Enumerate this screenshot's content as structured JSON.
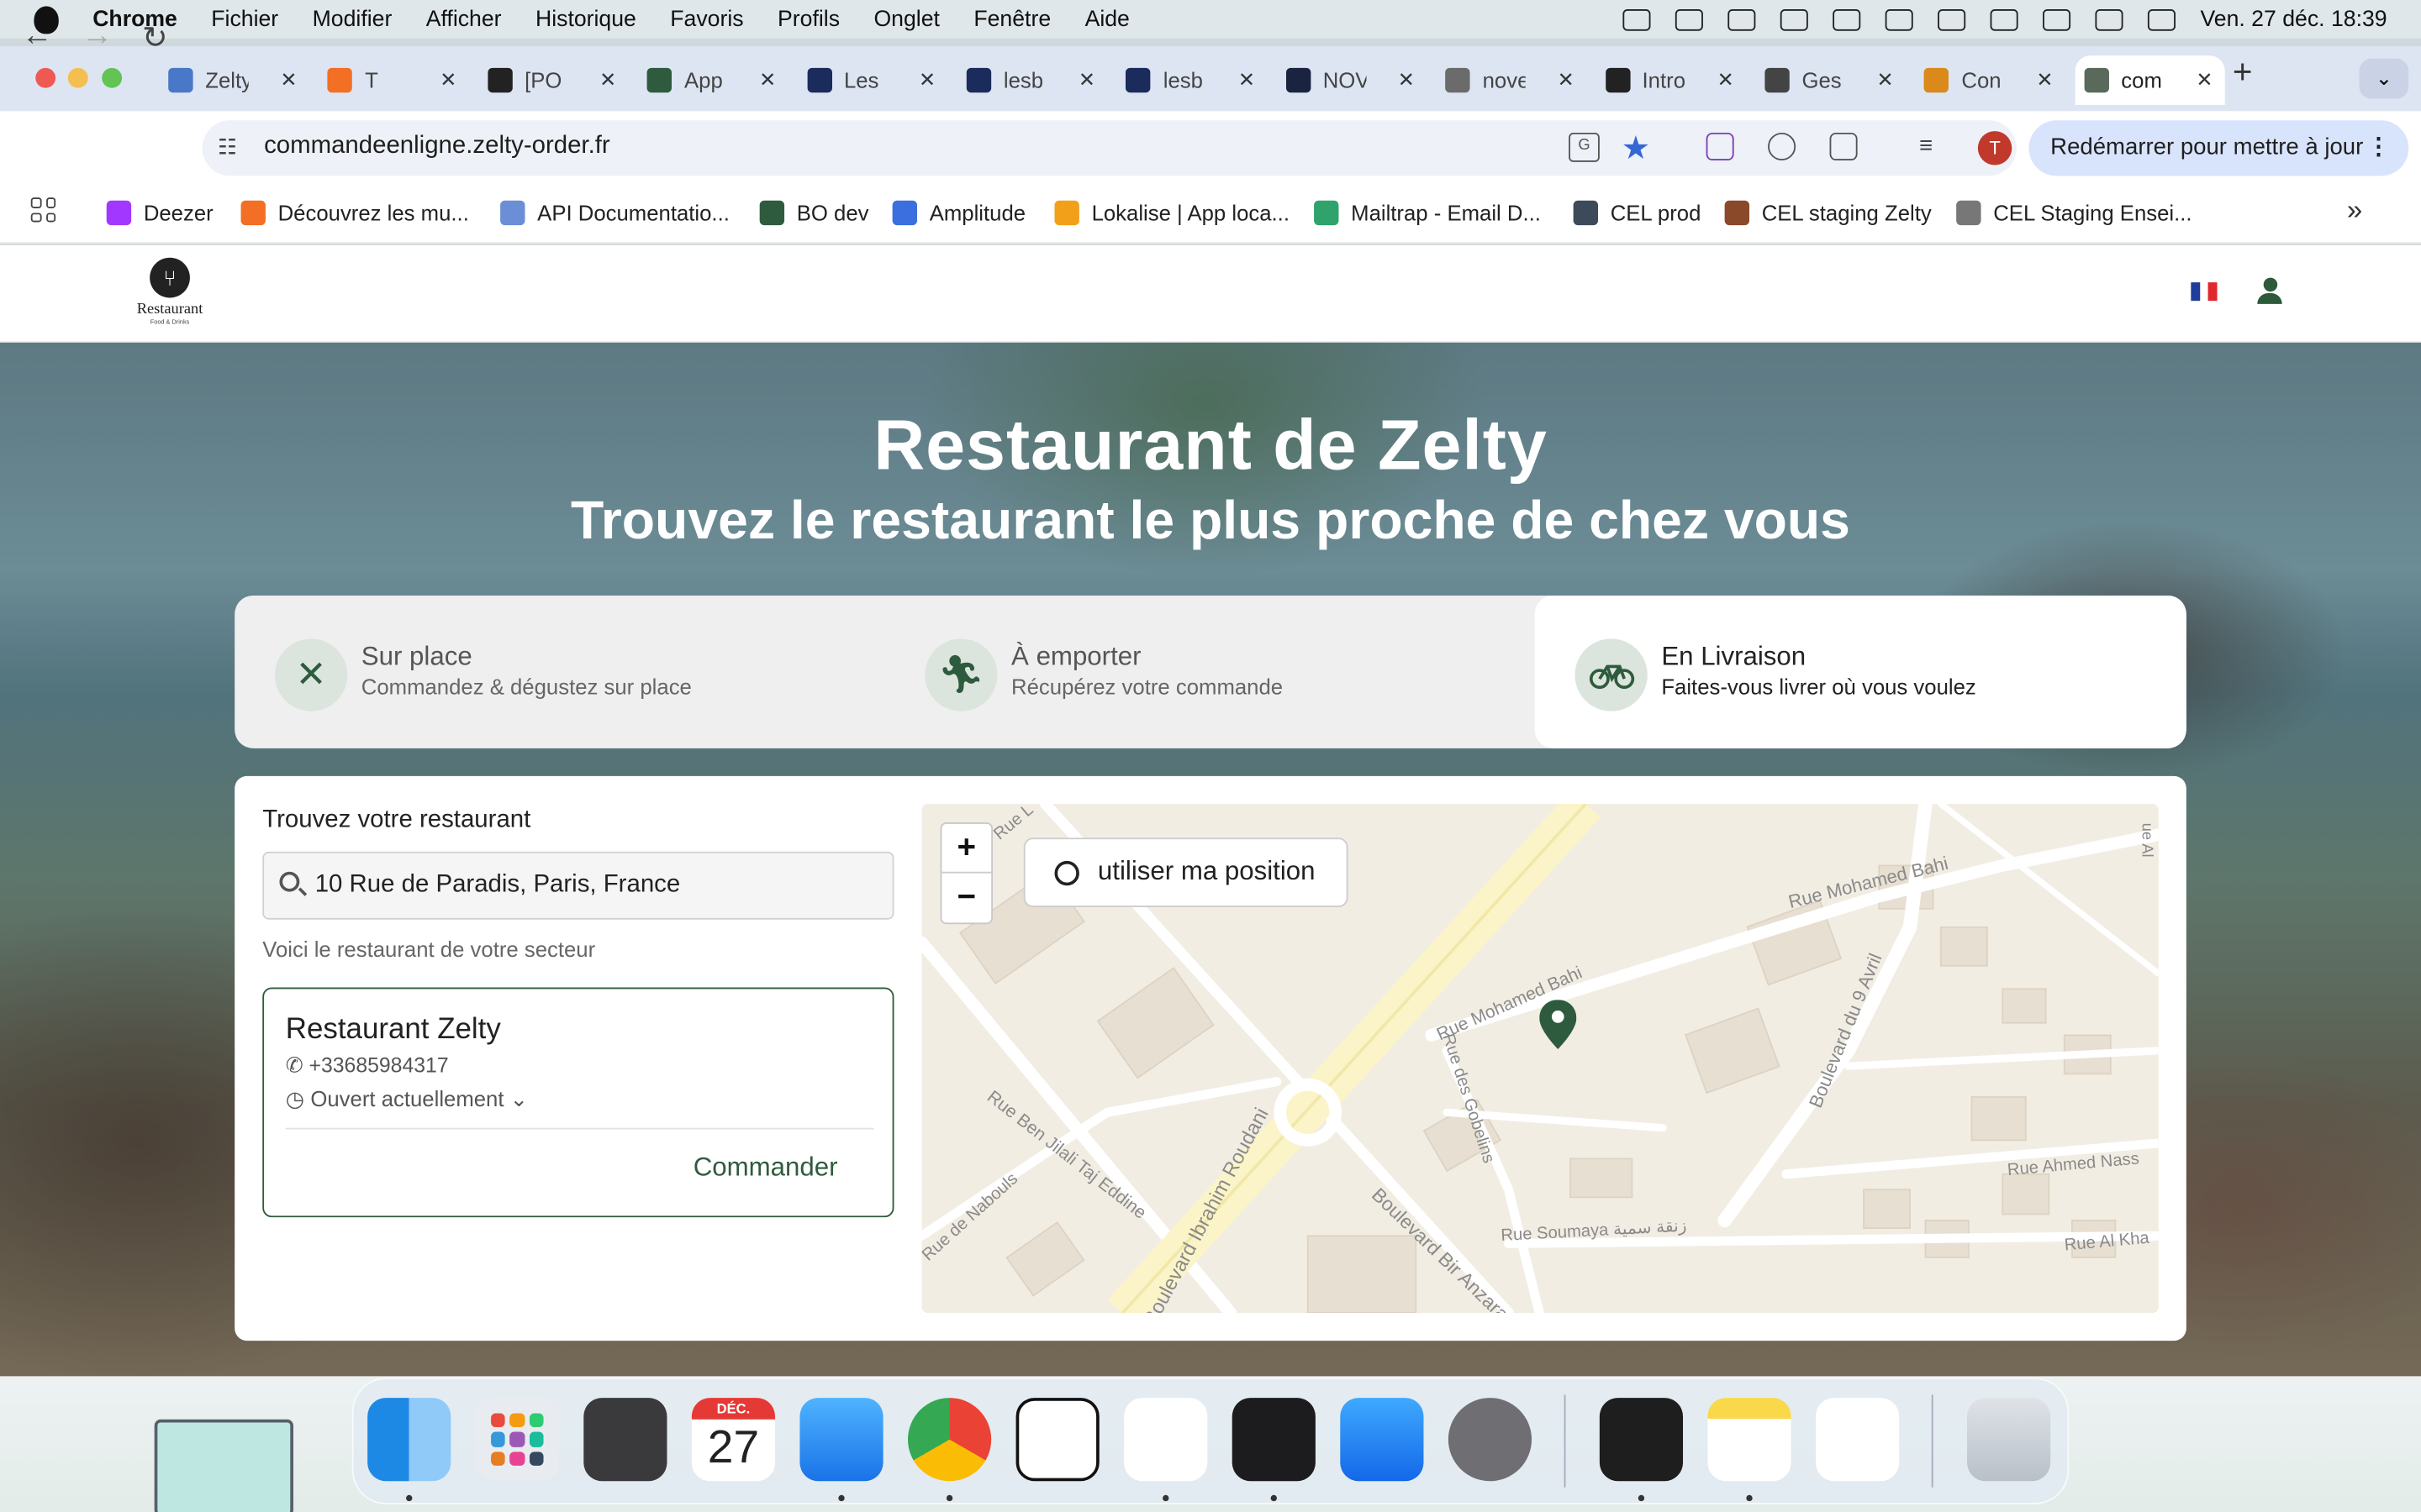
{
  "menubar": {
    "app": "Chrome",
    "items": [
      "Fichier",
      "Modifier",
      "Afficher",
      "Historique",
      "Favoris",
      "Profils",
      "Onglet",
      "Fenêtre",
      "Aide"
    ],
    "clock": "Ven. 27 déc.  18:39"
  },
  "tabs": [
    {
      "label": "Zelty",
      "favicon": "calendar-icon",
      "color": "#4a78c9"
    },
    {
      "label": "T",
      "favicon": "soundcloud-icon",
      "color": "#f26f23"
    },
    {
      "label": "[PO",
      "favicon": "linear-icon",
      "color": "#222222"
    },
    {
      "label": "App",
      "favicon": "zelty-icon",
      "color": "#2e5b3d"
    },
    {
      "label": "Les",
      "favicon": "burger-icon",
      "color": "#1b2b5c"
    },
    {
      "label": "lesb",
      "favicon": "burger-icon",
      "color": "#1b2b5c"
    },
    {
      "label": "lesb",
      "favicon": "burger-icon",
      "color": "#1b2b5c"
    },
    {
      "label": "NOV",
      "favicon": "nov-icon",
      "color": "#1a2440"
    },
    {
      "label": "nove",
      "favicon": "globe-icon",
      "color": "#6b6b6b"
    },
    {
      "label": "Intro",
      "favicon": "openai-icon",
      "color": "#222222"
    },
    {
      "label": "Ges",
      "favicon": "openai-icon",
      "color": "#444444"
    },
    {
      "label": "Con",
      "favicon": "scooter-icon",
      "color": "#d98a1a"
    },
    {
      "label": "com",
      "favicon": "restaurant-icon",
      "color": "#5a6a5a",
      "active": true
    }
  ],
  "toolbar": {
    "url": "commandeenligne.zelty-order.fr",
    "update_label": "Redémarrer pour mettre à jour",
    "profile_initial": "T"
  },
  "bookmarks": [
    {
      "label": "Deezer",
      "color": "#a238ff"
    },
    {
      "label": "Découvrez les mu...",
      "color": "#f26f23"
    },
    {
      "label": "API Documentatio...",
      "color": "#6a8fd6"
    },
    {
      "label": "BO dev",
      "color": "#2e5b3d"
    },
    {
      "label": "Amplitude",
      "color": "#3b6fe0"
    },
    {
      "label": "Lokalise | App loca...",
      "color": "#f2a01a"
    },
    {
      "label": "Mailtrap - Email D...",
      "color": "#2fa36b"
    },
    {
      "label": "CEL prod",
      "color": "#3d4a5a"
    },
    {
      "label": "CEL staging Zelty",
      "color": "#8a4a2a"
    },
    {
      "label": "CEL Staging Ensei...",
      "color": "#777777"
    }
  ],
  "site": {
    "logo_text": "Restaurant",
    "logo_sub": "Food & Drinks",
    "title": "Restaurant de Zelty",
    "subtitle": "Trouvez le restaurant le plus proche de chez vous"
  },
  "modes": [
    {
      "title": "Sur place",
      "desc": "Commandez & dégustez sur place",
      "icon": "utensils-icon"
    },
    {
      "title": "À emporter",
      "desc": "Récupérez votre commande",
      "icon": "walking-icon"
    },
    {
      "title": "En Livraison",
      "desc": "Faites-vous livrer où vous voulez",
      "icon": "bicycle-icon",
      "selected": true
    }
  ],
  "finder": {
    "title": "Trouvez votre restaurant",
    "search_value": "10 Rue de Paradis, Paris, France",
    "sector_text": "Voici le restaurant de votre secteur",
    "restaurant": {
      "name": "Restaurant Zelty",
      "phone": "+33685984317",
      "status": "Ouvert actuellement",
      "order_label": "Commander"
    }
  },
  "map": {
    "zoom_in": "+",
    "zoom_out": "−",
    "locate_label": "utiliser ma position",
    "streets": [
      "Rue Mohamed Bahi",
      "Rue Mohamed Bahi",
      "Boulevard du 9 Avril",
      "Rue des Gobelins",
      "Rue Ben Jilali Taj Eddine",
      "Rue de Nabouls",
      "Boulevard Ibrahim Roudani",
      "Boulevard Bir Anzarane",
      "Rue Soumaya زنقة سمية",
      "Rue Ahmed Nass",
      "Rue Al Kha",
      "Rue L",
      "ue Al"
    ]
  },
  "dock": {
    "calendar_month": "DÉC.",
    "calendar_day": "27",
    "apps": [
      "finder-icon",
      "launchpad-icon",
      "calculator-icon",
      "calendar-icon",
      "mail-icon",
      "chrome-icon",
      "notion-icon",
      "slack-icon",
      "terminal-icon",
      "app-store-icon",
      "settings-icon",
      "figma-icon",
      "notes-icon",
      "zelty-icon",
      "trash-icon"
    ]
  },
  "colors": {
    "brand": "#2f5b3d",
    "mode_icon_bg": "#dce5dd",
    "map_road": "#fbf4c8"
  }
}
